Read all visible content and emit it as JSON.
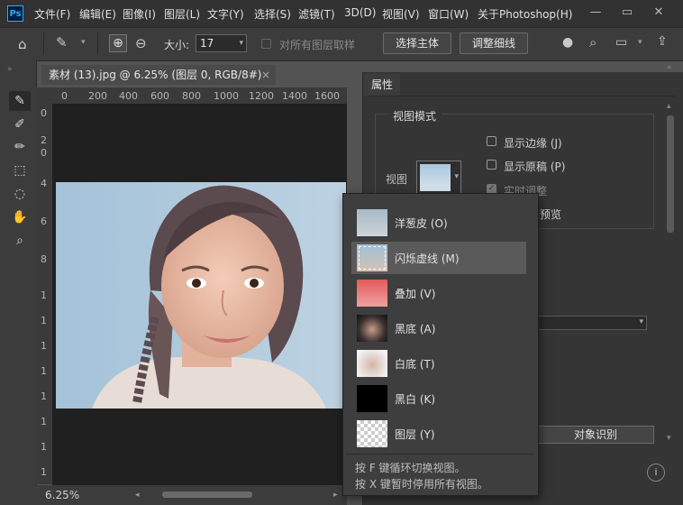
{
  "app": {
    "logo": "Ps"
  },
  "menu": [
    "文件(F)",
    "编辑(E)",
    "图像(I)",
    "图层(L)",
    "文字(Y)",
    "选择(S)",
    "滤镜(T)",
    "3D(D)",
    "视图(V)",
    "窗口(W)",
    "关于Photoshop(H)"
  ],
  "options": {
    "size_label": "大小:",
    "size_value": "17",
    "sample_all_layers": "对所有图层取样",
    "select_subject": "选择主体",
    "refine_edge": "调整细线"
  },
  "document": {
    "tab_title": "素材 (13).jpg @ 6.25% (图层 0, RGB/8#)",
    "close_glyph": "×",
    "zoom": "6.25%",
    "ruler_h": [
      "0",
      "200",
      "400",
      "600",
      "800",
      "1000",
      "1200",
      "1400",
      "1600"
    ],
    "ruler_v": [
      "0",
      "2",
      "0",
      "4",
      "6",
      "8",
      "1",
      "1",
      "1",
      "1",
      "1",
      "1",
      "1",
      "1"
    ]
  },
  "properties": {
    "tab": "属性",
    "view_mode_label": "视图模式",
    "view_label": "视图",
    "show_edge": "显示边缘 (J)",
    "show_original": "显示原稿 (P)",
    "realtime_adjust": "实时调整",
    "hq_preview_partial": "预览",
    "output_button_partial": "对象识别"
  },
  "view_modes": [
    {
      "label": "洋葱皮 (O)",
      "thumb": "onion"
    },
    {
      "label": "闪烁虚线 (M)",
      "thumb": "marching",
      "selected": true
    },
    {
      "label": "叠加 (V)",
      "thumb": "overlay"
    },
    {
      "label": "黑底 (A)",
      "thumb": "black"
    },
    {
      "label": "白底 (T)",
      "thumb": "white"
    },
    {
      "label": "黑白 (K)",
      "thumb": "bw"
    },
    {
      "label": "图层 (Y)",
      "thumb": "layer"
    }
  ],
  "view_hints": [
    "按 F 键循环切换视图。",
    "按 X 键暂时停用所有视图。"
  ],
  "colors": {
    "accent": "#31a8ff",
    "menubar": "#323232",
    "panel": "#353535",
    "selected_row": "#5a5a5a"
  }
}
